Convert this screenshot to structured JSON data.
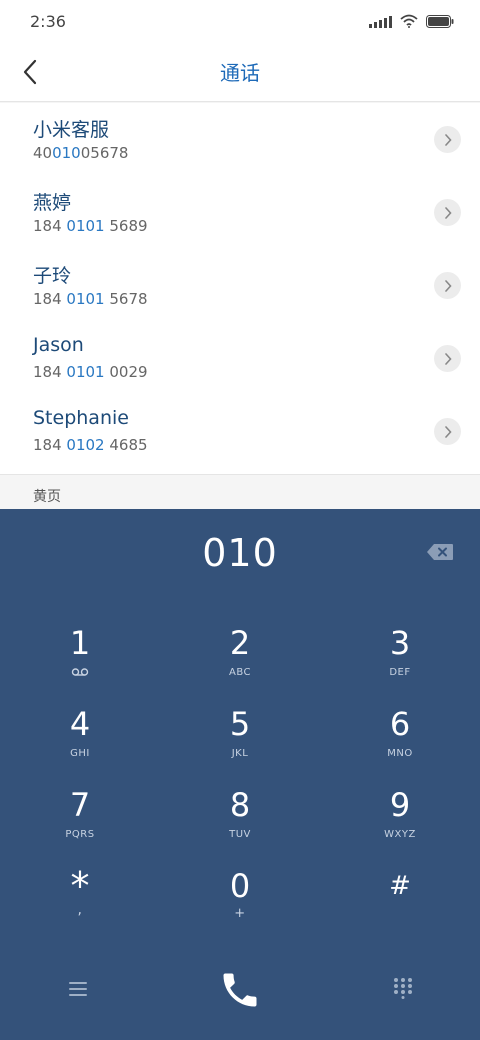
{
  "status_bar": {
    "time": "2:36"
  },
  "header": {
    "title": "通话"
  },
  "contacts": [
    {
      "name": "小米客服",
      "number_parts": [
        "40",
        "010",
        "05678"
      ]
    },
    {
      "name": "燕婷",
      "number_parts": [
        "184 ",
        "0101",
        " 5689"
      ]
    },
    {
      "name": "子玲",
      "number_parts": [
        "184 ",
        "0101",
        " 5678"
      ]
    },
    {
      "name": "Jason",
      "number_parts": [
        "184 ",
        "0101",
        " 0029"
      ]
    },
    {
      "name": "Stephanie",
      "number_parts": [
        "184 ",
        "0102",
        " 4685"
      ]
    }
  ],
  "section": {
    "yellow_pages": "黄页"
  },
  "dialpad": {
    "display": "010",
    "keys": [
      {
        "digit": "1",
        "sub": ""
      },
      {
        "digit": "2",
        "sub": "ABC"
      },
      {
        "digit": "3",
        "sub": "DEF"
      },
      {
        "digit": "4",
        "sub": "GHI"
      },
      {
        "digit": "5",
        "sub": "JKL"
      },
      {
        "digit": "6",
        "sub": "MNO"
      },
      {
        "digit": "7",
        "sub": "PQRS"
      },
      {
        "digit": "8",
        "sub": "TUV"
      },
      {
        "digit": "9",
        "sub": "WXYZ"
      },
      {
        "digit": "*",
        "sub": ","
      },
      {
        "digit": "0",
        "sub": "+"
      },
      {
        "digit": "#",
        "sub": ""
      }
    ]
  },
  "colors": {
    "accent": "#1e6ab8",
    "dialpad_bg": "#34527a",
    "number_highlight": "#2a78c2"
  },
  "icons": {
    "back": "chevron-left-icon",
    "detail": "chevron-right-icon",
    "backspace": "backspace-icon",
    "voicemail": "voicemail-icon",
    "menu": "menu-icon",
    "call": "phone-icon",
    "keypad": "dialpad-icon"
  }
}
